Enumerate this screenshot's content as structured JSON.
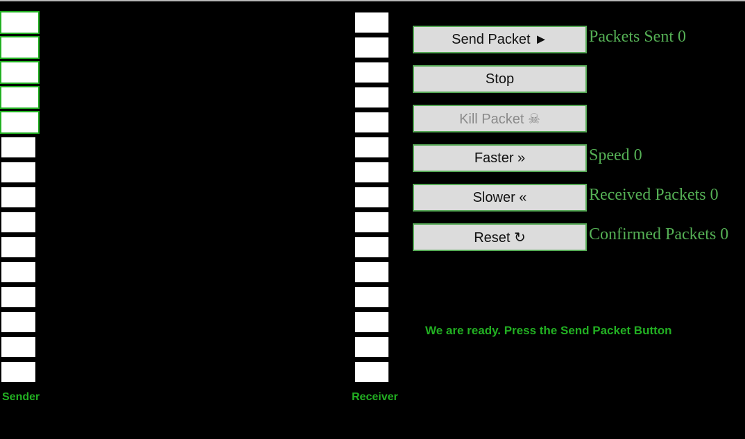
{
  "buttons": {
    "send": "Send Packet ►",
    "stop": "Stop",
    "kill": "Kill Packet ☠",
    "faster": "Faster »",
    "slower": "Slower «",
    "reset": "Reset ↻"
  },
  "stats": {
    "packets_sent": "Packets Sent 0",
    "speed": "Speed 0",
    "received": "Received Packets 0",
    "confirmed": "Confirmed Packets 0"
  },
  "status_message": "We are ready. Press the Send Packet Button",
  "labels": {
    "sender": "Sender",
    "receiver": "Receiver"
  },
  "sender_slots": 15,
  "receiver_slots": 15,
  "window_size": 5,
  "colors": {
    "accent": "#22b022",
    "stat_text": "#55b055",
    "background": "#000000"
  }
}
